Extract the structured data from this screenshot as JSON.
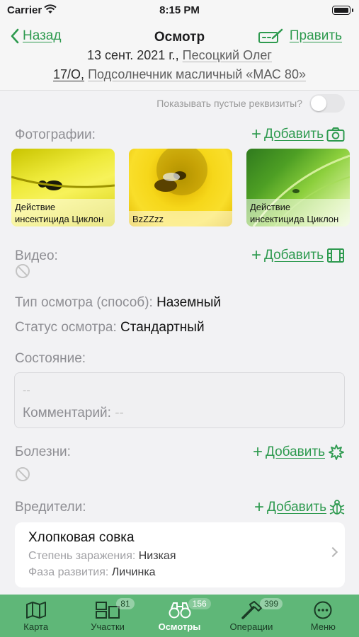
{
  "status_bar": {
    "carrier": "Carrier",
    "time": "8:15 PM"
  },
  "nav": {
    "back_label": "Назад",
    "title": "Осмотр",
    "edit_label": "Править",
    "date": "13 сент. 2021 г.,",
    "person": "Песоцкий Олег",
    "field_code": "17/О,",
    "crop": "Подсолнечник масличный «МАС 80»"
  },
  "toggle": {
    "label": "Показывать пустые реквизиты?",
    "state": "off"
  },
  "photos": {
    "label": "Фотографии:",
    "add_label": "Добавить",
    "items": [
      {
        "caption": "Действие инсектицида Циклон"
      },
      {
        "caption": "BzZZzz"
      },
      {
        "caption": "Действие инсектицида Циклон"
      }
    ]
  },
  "video": {
    "label": "Видео:",
    "add_label": "Добавить"
  },
  "inspection_type": {
    "key": "Тип осмотра (способ):",
    "value": "Наземный"
  },
  "inspection_status": {
    "key": "Статус осмотра:",
    "value": "Стандартный"
  },
  "state": {
    "label": "Состояние:",
    "value": "--",
    "comment_key": "Комментарий:",
    "comment_value": "--"
  },
  "diseases": {
    "label": "Болезни:",
    "add_label": "Добавить"
  },
  "pests": {
    "label": "Вредители:",
    "add_label": "Добавить",
    "items": [
      {
        "name": "Хлопковая совка",
        "infection_key": "Степень заражения:",
        "infection_value": "Низкая",
        "phase_key": "Фаза развития:",
        "phase_value": "Личинка"
      }
    ]
  },
  "tabbar": {
    "items": [
      {
        "label": "Карта",
        "badge": "",
        "icon": "map-icon"
      },
      {
        "label": "Участки",
        "badge": "81",
        "icon": "fields-icon"
      },
      {
        "label": "Осмотры",
        "badge": "156",
        "icon": "binoculars-icon",
        "active": true
      },
      {
        "label": "Операции",
        "badge": "399",
        "icon": "hammer-icon"
      },
      {
        "label": "Меню",
        "badge": "",
        "icon": "more-icon"
      }
    ]
  },
  "colors": {
    "accent": "#2e9a4f",
    "tabbar": "#5fb778",
    "background": "#f2f2f4"
  }
}
